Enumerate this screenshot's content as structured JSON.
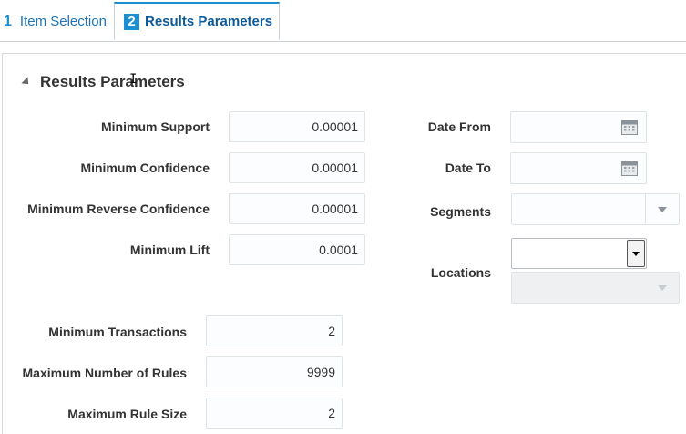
{
  "tabs": [
    {
      "number": "1",
      "label": "Item Selection"
    },
    {
      "number": "2",
      "label": "Results Parameters"
    }
  ],
  "section": {
    "title": "Results Parameters"
  },
  "cursor": {
    "glyph": "I"
  },
  "left_fields": [
    {
      "label": "Minimum Support",
      "value": "0.00001"
    },
    {
      "label": "Minimum Confidence",
      "value": "0.00001"
    },
    {
      "label": "Minimum Reverse Confidence",
      "value": "0.00001"
    },
    {
      "label": "Minimum Lift",
      "value": "0.0001"
    }
  ],
  "right_fields": {
    "date_from": {
      "label": "Date From",
      "value": "",
      "icon": "calendar-icon"
    },
    "date_to": {
      "label": "Date To",
      "value": "",
      "icon": "calendar-icon"
    },
    "segments": {
      "label": "Segments",
      "value": "",
      "icon": "chevron-down-icon"
    },
    "locations": {
      "label": "Locations",
      "value": "",
      "icon": "chevron-down-icon"
    }
  },
  "bottom_fields": [
    {
      "label": "Minimum Transactions",
      "value": "2"
    },
    {
      "label": "Maximum Number of Rules",
      "value": "9999"
    },
    {
      "label": "Maximum Rule Size",
      "value": "2"
    }
  ],
  "colors": {
    "accent": "#1c8fd3",
    "tab_text": "#1d74b8",
    "field_border": "#dfe4e7"
  }
}
